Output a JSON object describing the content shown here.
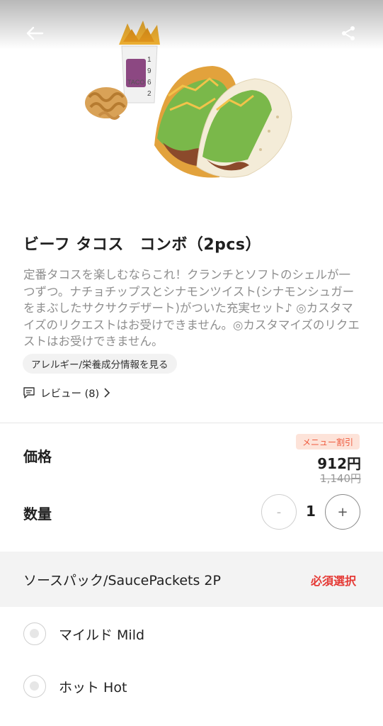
{
  "header": {
    "back_icon": "arrow-left-icon",
    "share_icon": "share-icon"
  },
  "product": {
    "image_label": "beef-taco-combo-photo",
    "title": "ビーフ タコス　コンボ（2pcs）",
    "description": "定番タコスを楽しむならこれ！クランチとソフトのシェルが一つずつ。ナチョチップスとシナモンツイスト(シナモンシュガーをまぶしたサクサクデザート)がついた充実セット♪ ◎カスタマイズのリクエストはお受けできません。◎カスタマイズのリクエストはお受けできません。",
    "allergy_button": "アレルギー/栄養成分情報を見る",
    "reviews_label": "レビュー (8)",
    "reviews_icon": "comment-icon"
  },
  "pricing": {
    "label": "価格",
    "badge": "メニュー割引",
    "price": "912円",
    "original_price": "1,140円",
    "badge_color": "#ef5b3f"
  },
  "quantity": {
    "label": "数量",
    "minus": "-",
    "value": "1",
    "plus": "+"
  },
  "options_section": {
    "title": "ソースパック/SaucePackets 2P",
    "required": "必須選択",
    "required_color": "#e53935",
    "options": [
      {
        "label": "マイルド Mild"
      },
      {
        "label": "ホット Hot"
      }
    ]
  }
}
